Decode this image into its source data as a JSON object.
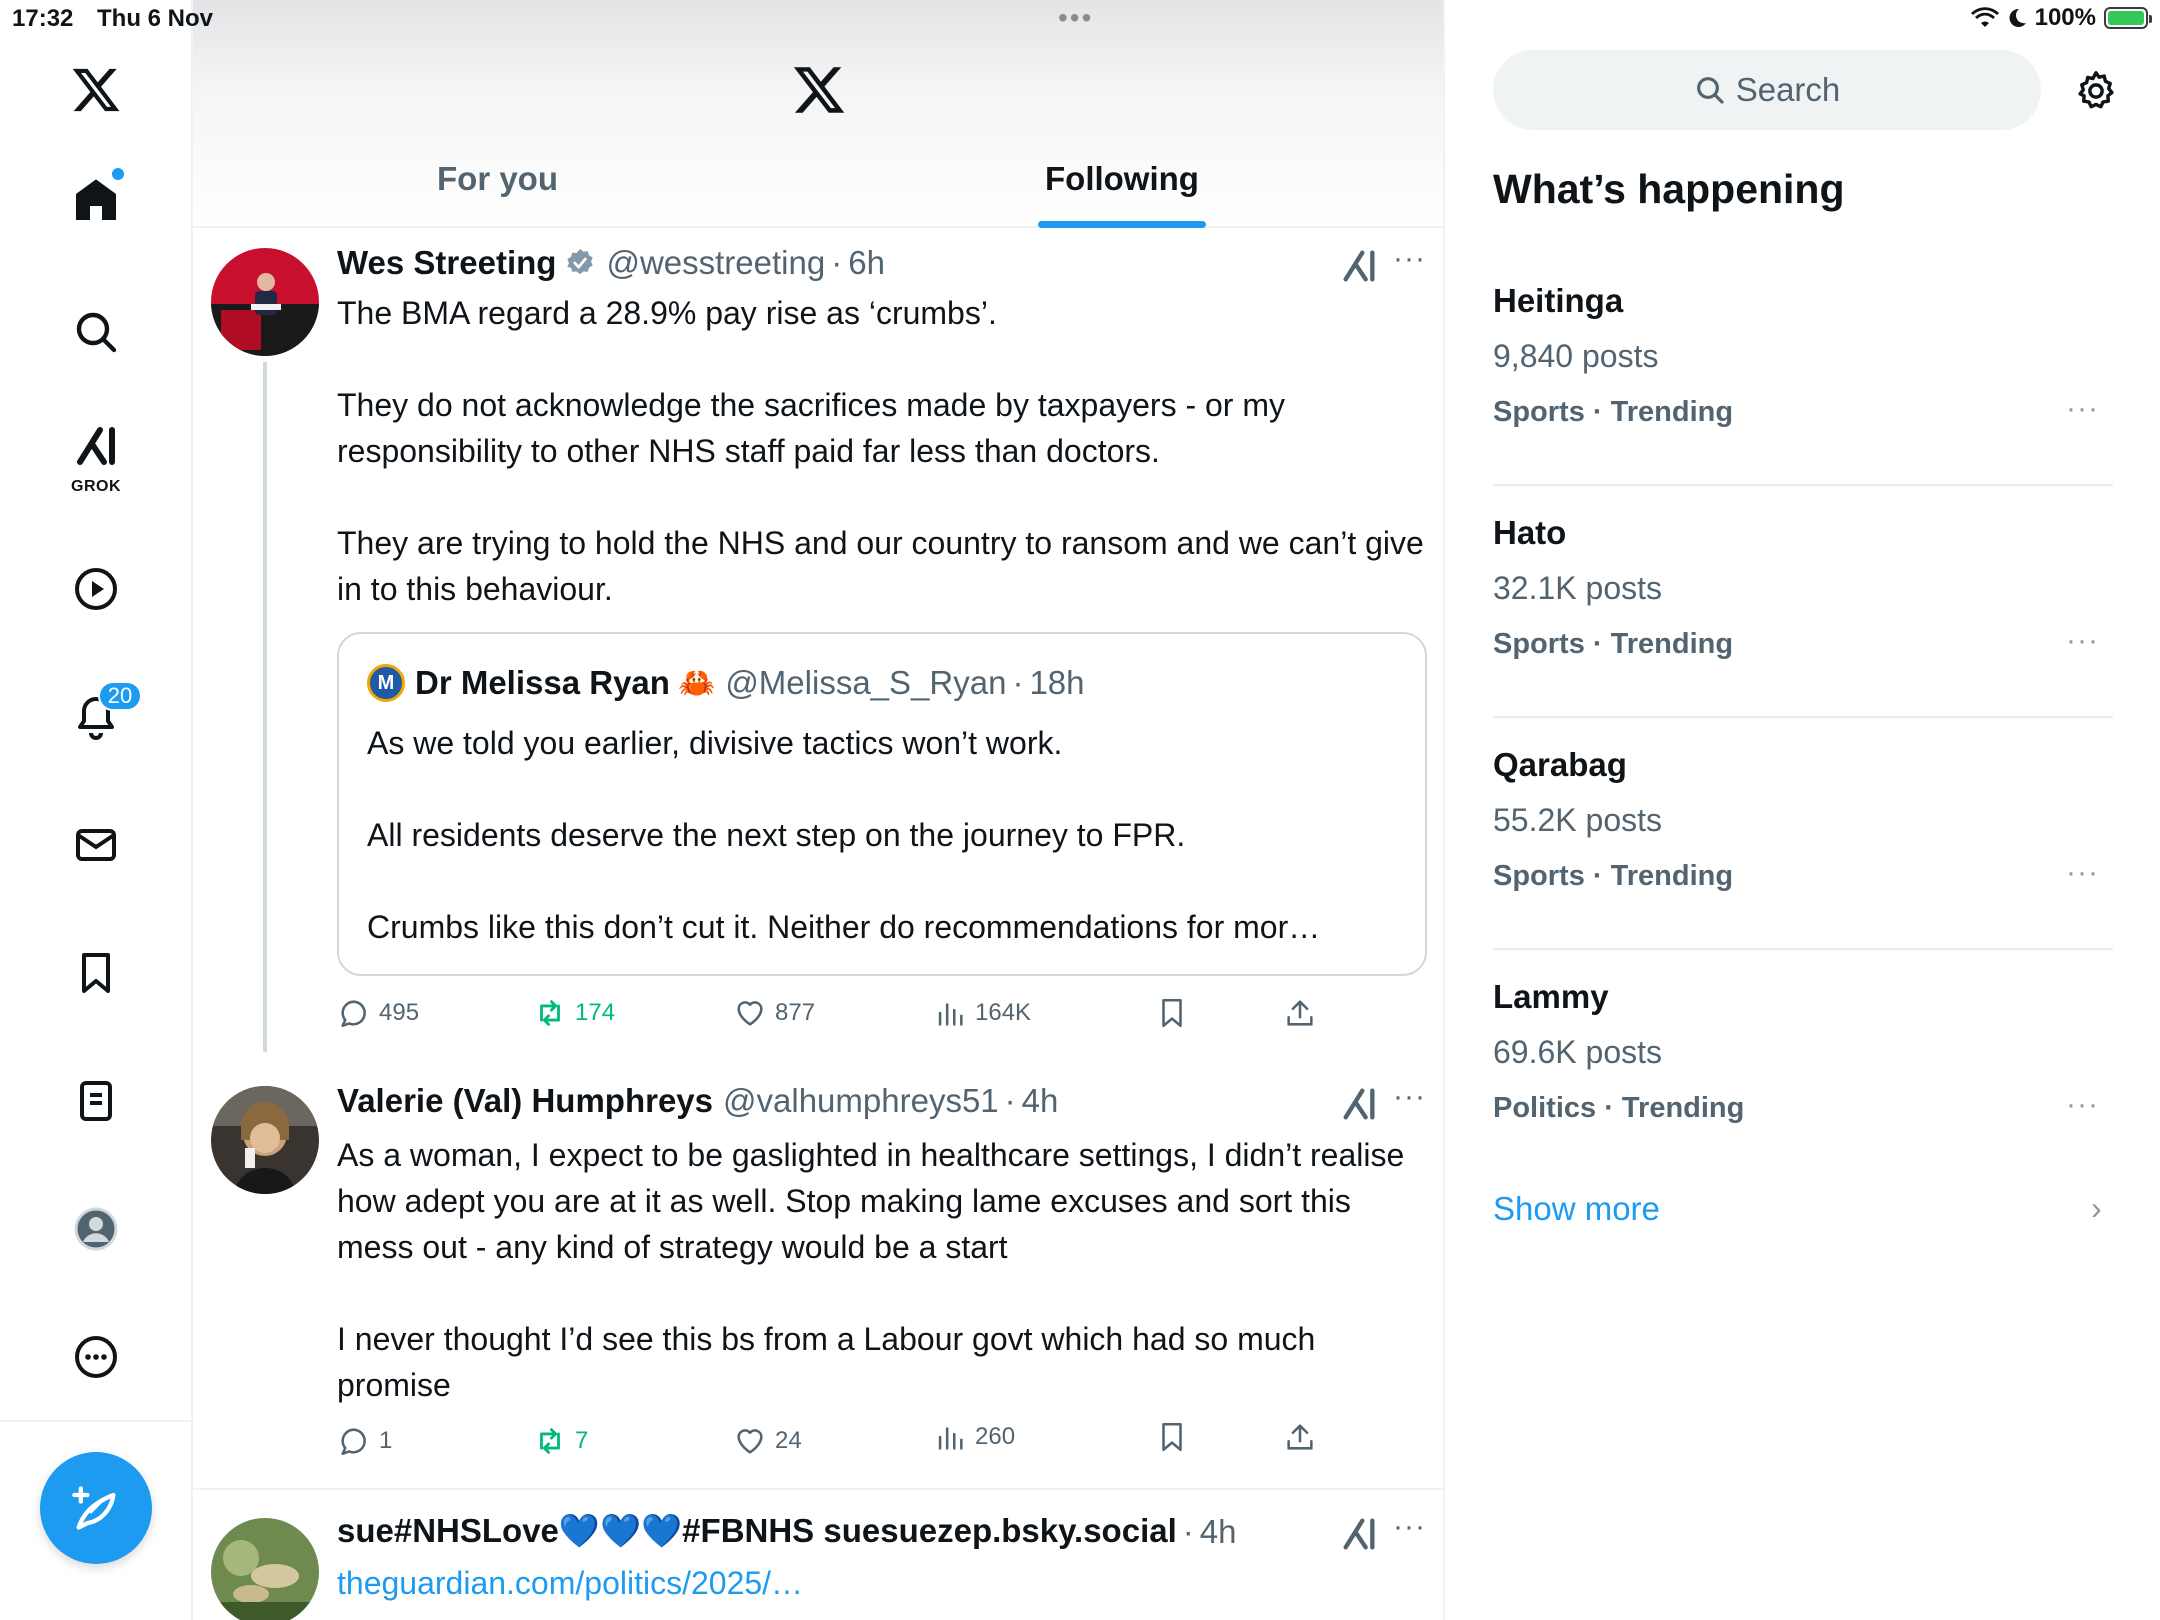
{
  "status": {
    "time": "17:32",
    "date": "Thu 6 Nov",
    "battery": "100%",
    "battery_level": 1.0
  },
  "nav": {
    "items": [
      "x-logo",
      "home",
      "search",
      "grok",
      "video",
      "notifications",
      "messages",
      "bookmarks",
      "lists",
      "profile",
      "more"
    ],
    "grok_label": "GROK",
    "notification_count": "20"
  },
  "header": {
    "tabs": [
      {
        "label": "For you",
        "active": false
      },
      {
        "label": "Following",
        "active": true
      }
    ]
  },
  "posts": [
    {
      "name": "Wes Streeting",
      "verified": true,
      "handle": "@wesstreeting",
      "time": "6h",
      "text": "The BMA regard a 28.9% pay rise as ‘crumbs’.\n\nThey do not acknowledge the sacrifices made by taxpayers - or my responsibility to other NHS staff paid far less than doctors.\n\nThey are trying to hold the NHS and our country to ransom and we can’t give in to this behaviour.",
      "quote": {
        "avatar_letter": "M",
        "name": "Dr Melissa Ryan",
        "emoji": "🦀",
        "handle": "@Melissa_S_Ryan",
        "time": "18h",
        "text": "As we told you earlier, divisive tactics won’t work.\n\nAll residents deserve the next step on the journey to FPR.\n\nCrumbs like this don’t cut it. Neither do recommendations for mor…"
      },
      "replies": "495",
      "reposts": "174",
      "likes": "877",
      "views": "164K"
    },
    {
      "name": "Valerie (Val) Humphreys",
      "handle": "@valhumphreys51",
      "time": "4h",
      "text": "As a woman, I expect to be gaslighted in healthcare settings, I didn’t realise how adept you are at it as well. Stop making lame excuses and sort this mess out - any kind of strategy would be a start\n\nI never thought I’d see this bs from a Labour govt which had so much promise",
      "replies": "1",
      "reposts": "7",
      "likes": "24",
      "views": "260"
    },
    {
      "name": "sue#NHSLove💙💙💙#FBNHS suesuezep.bsky.social",
      "handle": "",
      "time": "4h",
      "link": "theguardian.com/politics/2025/…"
    }
  ],
  "sidebar": {
    "search_placeholder": "Search",
    "title": "What’s happening",
    "trends": [
      {
        "name": "Heitinga",
        "posts": "9,840 posts",
        "meta": "Sports · Trending"
      },
      {
        "name": "Hato",
        "posts": "32.1K posts",
        "meta": "Sports · Trending"
      },
      {
        "name": "Qarabag",
        "posts": "55.2K posts",
        "meta": "Sports · Trending"
      },
      {
        "name": "Lammy",
        "posts": "69.6K posts",
        "meta": "Politics · Trending"
      }
    ],
    "show_more": "Show more",
    "more_glyph": "···",
    "chevron": "›"
  },
  "glyphs": {
    "dots": "•••",
    "more": "···",
    "separator": "·"
  },
  "colors": {
    "accent": "#1d9bf0",
    "repost": "#00ba7c",
    "secondary_text": "#536471",
    "border": "#eff3f4"
  }
}
